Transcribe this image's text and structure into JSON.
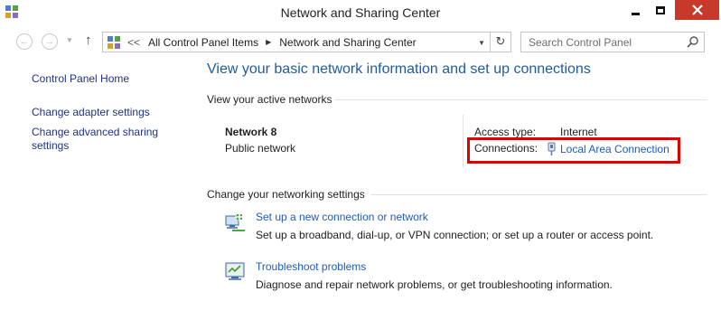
{
  "window": {
    "title": "Network and Sharing Center"
  },
  "nav": {
    "breadcrumb_more": "<<",
    "breadcrumbs": [
      "All Control Panel Items",
      "Network and Sharing Center"
    ],
    "search_placeholder": "Search Control Panel"
  },
  "sidebar": {
    "items": [
      {
        "label": "Control Panel Home"
      },
      {
        "label": "Change adapter settings"
      },
      {
        "label": "Change advanced sharing settings"
      }
    ]
  },
  "main": {
    "title": "View your basic network information and set up connections",
    "active_networks_label": "View your active networks",
    "network": {
      "name": "Network  8",
      "type": "Public network",
      "access_type_label": "Access type:",
      "access_type_value": "Internet",
      "connections_label": "Connections:",
      "connection_name": "Local Area Connection"
    },
    "settings_label": "Change your networking settings",
    "tasks": [
      {
        "icon": "network-setup-icon",
        "link": "Set up a new connection or network",
        "description": "Set up a broadband, dial-up, or VPN connection; or set up a router or access point."
      },
      {
        "icon": "troubleshoot-icon",
        "link": "Troubleshoot problems",
        "description": "Diagnose and repair network problems, or get troubleshooting information."
      }
    ]
  },
  "colors": {
    "link": "#1e5bbe",
    "title_blue": "#1e5a9e",
    "sidebar_link": "#1e3287",
    "highlight_red": "#e00000",
    "close_button": "#c7392b"
  }
}
